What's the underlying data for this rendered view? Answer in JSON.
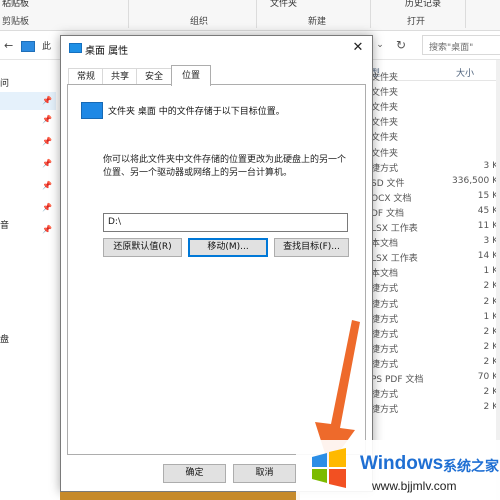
{
  "ribbon": {
    "top_texts": [
      "粘贴板",
      "文件夹",
      "历史记录"
    ],
    "groups": [
      "剪贴板",
      "组织",
      "新建",
      "打开"
    ]
  },
  "address": {
    "back_glyph": "←",
    "path_fragment": "此",
    "dropdown_glyph": "⌄",
    "refresh_glyph": "↻",
    "search_placeholder": "搜索\"桌面\""
  },
  "nav": {
    "texts": [
      "问",
      "音",
      "盘"
    ],
    "pin_glyph": "📌"
  },
  "file_list": {
    "columns": {
      "type": "型",
      "size": "大小"
    },
    "rows": [
      {
        "type": "文件夹",
        "size": ""
      },
      {
        "type": "文件夹",
        "size": ""
      },
      {
        "type": "文件夹",
        "size": ""
      },
      {
        "type": "文件夹",
        "size": ""
      },
      {
        "type": "文件夹",
        "size": ""
      },
      {
        "type": "文件夹",
        "size": ""
      },
      {
        "type": "捷方式",
        "size": "3 K"
      },
      {
        "type": "SD 文件",
        "size": "336,500 K"
      },
      {
        "type": "OCX 文档",
        "size": "15 K"
      },
      {
        "type": "DF 文档",
        "size": "45 K"
      },
      {
        "type": "LSX 工作表",
        "size": "11 K"
      },
      {
        "type": "本文档",
        "size": "3 K"
      },
      {
        "type": "LSX 工作表",
        "size": "14 K"
      },
      {
        "type": "本文档",
        "size": "1 K"
      },
      {
        "type": "捷方式",
        "size": "2 K"
      },
      {
        "type": "捷方式",
        "size": "2 K"
      },
      {
        "type": "捷方式",
        "size": "1 K"
      },
      {
        "type": "捷方式",
        "size": "2 K"
      },
      {
        "type": "捷方式",
        "size": "2 K"
      },
      {
        "type": "捷方式",
        "size": "2 K"
      },
      {
        "type": "PS PDF 文档",
        "size": "70 K"
      },
      {
        "type": "捷方式",
        "size": "2 K"
      },
      {
        "type": "捷方式",
        "size": "2 K"
      }
    ]
  },
  "dialog": {
    "title": "桌面 属性",
    "close_glyph": "✕",
    "tabs": [
      "常规",
      "共享",
      "安全",
      "位置"
    ],
    "active_tab": "位置",
    "description": "文件夹 桌面 中的文件存储于以下目标位置。",
    "info_line1": "你可以将此文件夹中文件存储的位置更改为此硬盘上的另一个",
    "info_line2": "位置、另一个驱动器或网络上的另一台计算机。",
    "path_value": "D:\\",
    "buttons": {
      "restore": "还原默认值(R)",
      "move": "移动(M)...",
      "find_target": "查找目标(F)..."
    },
    "footer": {
      "ok": "确定",
      "cancel": "取消"
    }
  },
  "watermark": {
    "brand": "Windows",
    "brand_cn": "系统之家",
    "url": "www.bjjmlv.com"
  },
  "colors": {
    "accent_blue": "#0078d7",
    "arrow": "#ee6a2b",
    "watermark_blue": "#1f6fd3"
  }
}
